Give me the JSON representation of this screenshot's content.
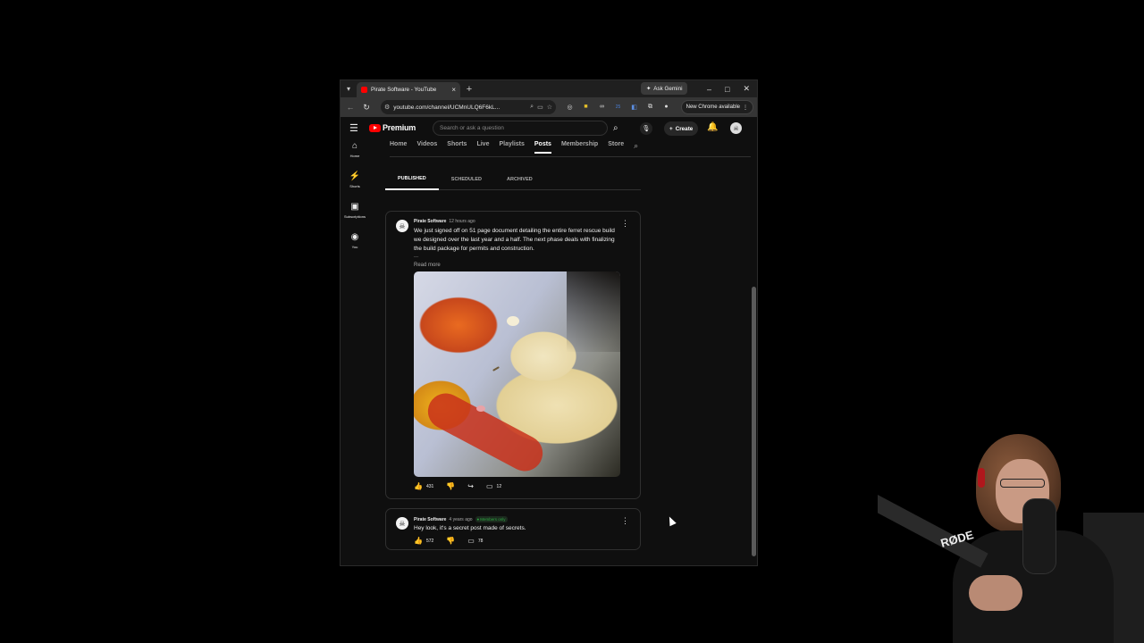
{
  "browser": {
    "tab_title": "Pirate Software - YouTube",
    "new_tab_symbol": "+",
    "gemini_label": "Ask Gemini",
    "url": "youtube.com/channel/UCMnULQ6F6kL...",
    "new_chrome_label": "New Chrome available",
    "ext_badge": "25"
  },
  "youtube": {
    "logo_text": "Premium",
    "search_placeholder": "Search or ask a question",
    "create_label": "Create",
    "guide": [
      {
        "label": "Home",
        "icon": "home-icon"
      },
      {
        "label": "Shorts",
        "icon": "shorts-icon"
      },
      {
        "label": "Subscriptions",
        "icon": "subscriptions-icon"
      },
      {
        "label": "You",
        "icon": "you-icon"
      }
    ],
    "channel_tabs": [
      "Home",
      "Videos",
      "Shorts",
      "Live",
      "Playlists",
      "Posts",
      "Membership",
      "Store"
    ],
    "active_channel_tab": "Posts",
    "sub_tabs": [
      "PUBLISHED",
      "SCHEDULED",
      "ARCHIVED"
    ],
    "active_sub_tab": "PUBLISHED"
  },
  "posts": [
    {
      "author": "Pirate Software",
      "time": "12 hours ago",
      "text": "We just signed off on 51 page document detailing the entire ferret rescue build we designed over the last year and a half. The next phase deals with finalizing the build package for permits and construction.",
      "ellipsis": "...",
      "read_more": "Read more",
      "likes": "431",
      "comments": "12"
    },
    {
      "author": "Pirate Software",
      "time": "4 years ago",
      "badge": "Members only",
      "text": "Hey look, it's a secret post made of secrets.",
      "likes": "572",
      "comments": "78"
    }
  ],
  "webcam": {
    "mic_brand": "RØDE"
  }
}
